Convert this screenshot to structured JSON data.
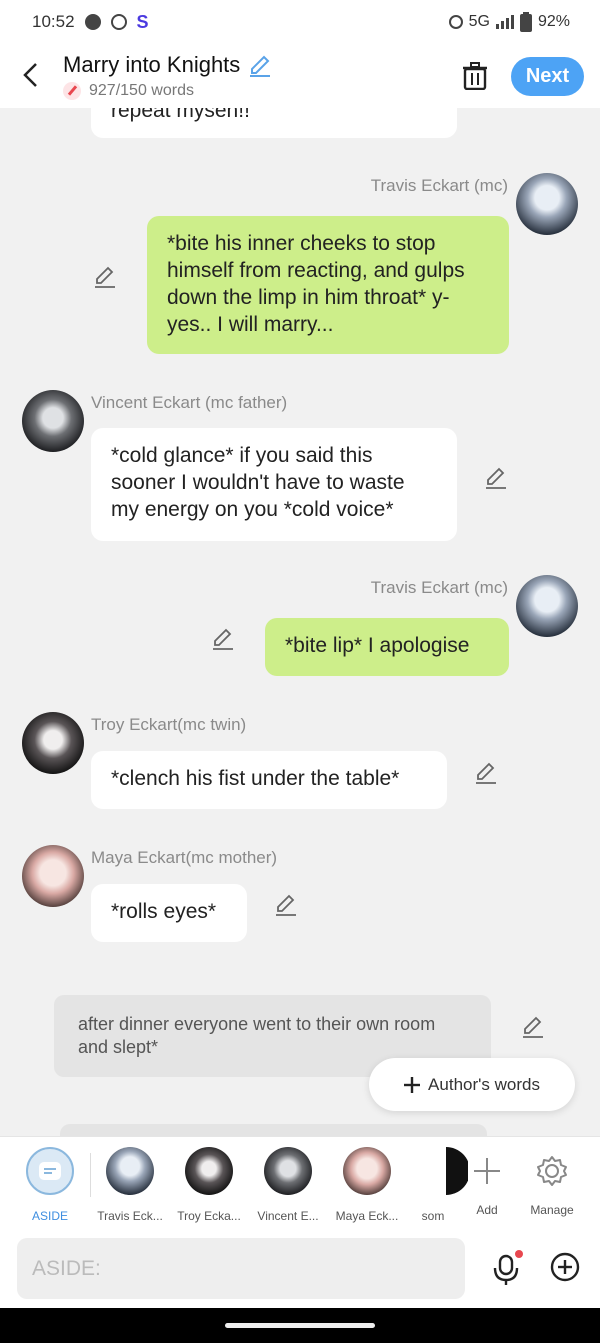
{
  "status": {
    "time": "10:52",
    "network": "5G",
    "battery": "92%",
    "app_letter": "S"
  },
  "header": {
    "title": "Marry into Knights",
    "word_count": "927/150 words",
    "next_label": "Next"
  },
  "messages": [
    {
      "type": "left-partial",
      "text": "repeat mysen!!"
    },
    {
      "type": "right",
      "name": "Travis Eckart (mc)",
      "text": "*bite his inner cheeks to stop himself from reacting, and gulps down the limp in him throat* y-yes.. I will marry..."
    },
    {
      "type": "left",
      "name": "Vincent Eckart (mc father)",
      "text": "*cold glance* if you said this sooner I wouldn't have to waste my energy on you *cold voice*"
    },
    {
      "type": "right",
      "name": "Travis Eckart (mc)",
      "text": "*bite lip* I apologise"
    },
    {
      "type": "left",
      "name": "Troy Eckart(mc twin)",
      "text": "*clench his fist under the table*"
    },
    {
      "type": "left",
      "name": "Maya Eckart(mc mother)",
      "text": "*rolls eyes*"
    },
    {
      "type": "aside",
      "text": "after dinner everyone went to their own room and slept*"
    }
  ],
  "author_words": "Author's words",
  "cast_bar": [
    {
      "label": "ASIDE"
    },
    {
      "label": "Travis Eck..."
    },
    {
      "label": "Troy Ecka..."
    },
    {
      "label": "Vincent E..."
    },
    {
      "label": "Maya Eck..."
    },
    {
      "label": "som"
    },
    {
      "label": "Add"
    },
    {
      "label": "Manage"
    }
  ],
  "input": {
    "placeholder": "ASIDE:"
  },
  "colors": {
    "accent": "#4da3f5",
    "right_bubble": "#cdee8a",
    "aside_bubble": "#e4e4e4"
  }
}
